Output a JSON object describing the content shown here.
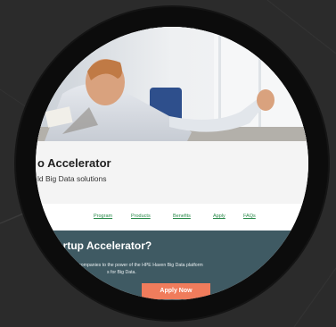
{
  "hero": {
    "title": "o Accelerator",
    "subtitle": "ld Big Data solutions"
  },
  "nav": {
    "items": [
      "Program",
      "Products",
      "Benefits",
      "Apply",
      "FAQs"
    ]
  },
  "band": {
    "title": "artup Accelerator?",
    "text_line1": "y stage companies to the power of the HPE Haven Big Data platform",
    "text_line2": "s for Big Data.",
    "button_label": "Apply Now"
  },
  "colors": {
    "nav_link": "#2a8a4a",
    "band_bg": "#3f5a63",
    "button_bg": "#f07c5c"
  }
}
